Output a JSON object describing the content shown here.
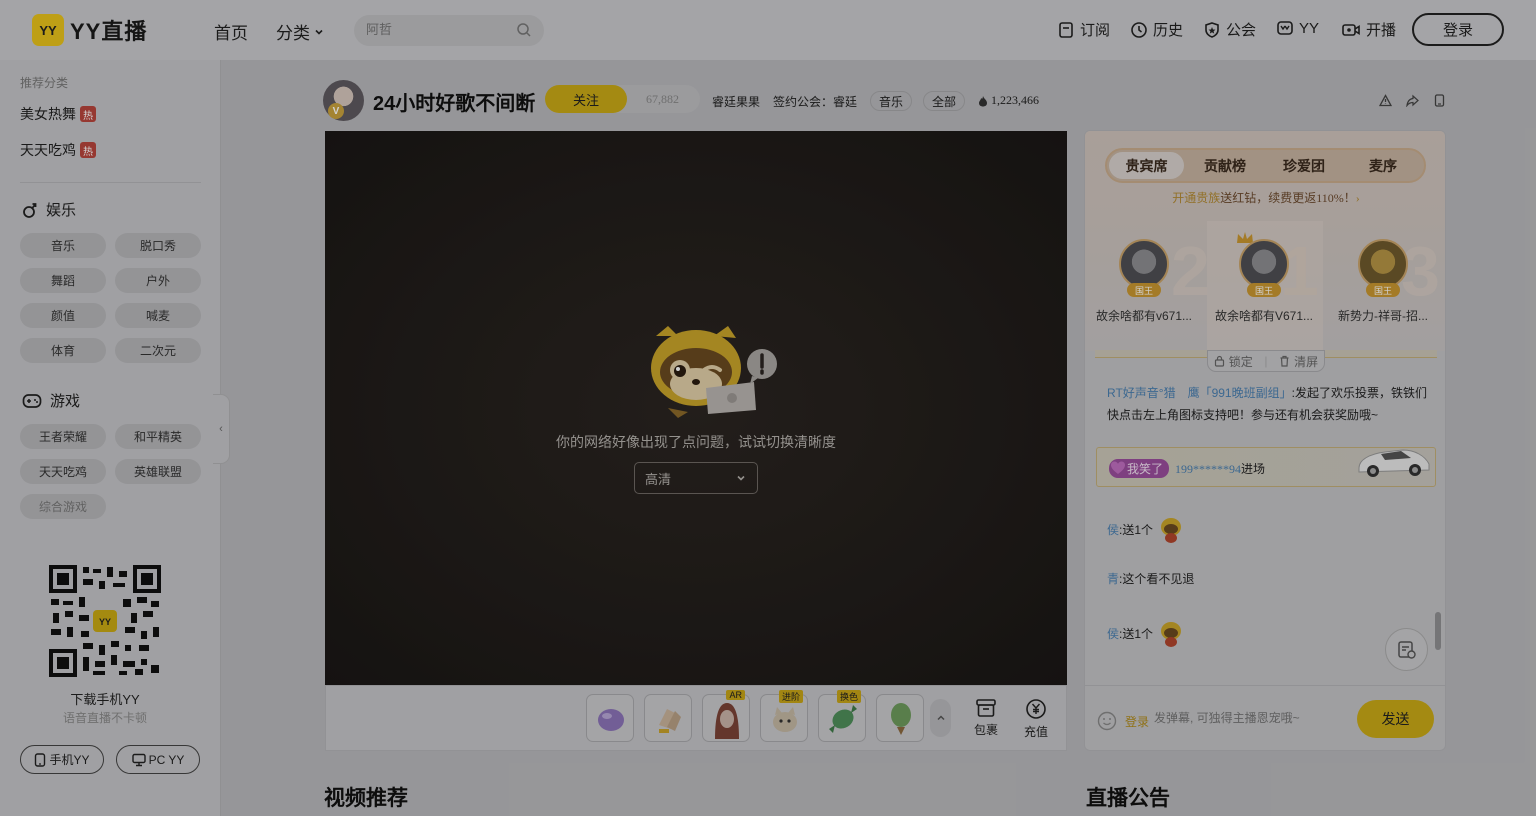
{
  "header": {
    "logo_mark": "YY",
    "logo_text": "YY直播",
    "nav": [
      "首页",
      "分类"
    ],
    "search_placeholder": "阿哲",
    "actions": [
      "订阅",
      "历史",
      "公会",
      "YY",
      "开播"
    ],
    "login": "登录"
  },
  "sidebar": {
    "caption": "推荐分类",
    "hot_items": [
      {
        "label": "美女热舞",
        "badge": "热"
      },
      {
        "label": "天天吃鸡",
        "badge": "热"
      }
    ],
    "entertainment": {
      "title": "娱乐",
      "chips": [
        "音乐",
        "脱口秀",
        "舞蹈",
        "户外",
        "颜值",
        "喊麦",
        "体育",
        "二次元"
      ]
    },
    "games": {
      "title": "游戏",
      "chips": [
        "王者荣耀",
        "和平精英",
        "天天吃鸡",
        "英雄联盟",
        "综合游戏"
      ]
    },
    "qr_caption": "下载手机YY",
    "qr_sub": "语音直播不卡顿",
    "downloads": [
      "手机YY",
      "PC YY"
    ]
  },
  "room": {
    "title": "24小时好歌不间断",
    "follow": "关注",
    "followers": "67,882",
    "anchor": "睿廷果果",
    "guild": "签约公会：睿廷",
    "tags": [
      "音乐",
      "全部"
    ],
    "heat": "1,223,466"
  },
  "player": {
    "error": "你的网络好像出现了点问题，试试切换清晰度",
    "quality": "高清",
    "gift_tags": {
      "g3": "AR",
      "g4": "进阶",
      "g5": "换色"
    },
    "tools": [
      "包裹",
      "充值"
    ]
  },
  "panel": {
    "tabs": [
      "贵宾席",
      "贡献榜",
      "珍爱团",
      "麦序"
    ],
    "noble_pre": "开通贵族",
    "noble_post": "送红钻，续费更返110%！",
    "vips": [
      {
        "rank": "2",
        "badge": "国王",
        "name": "故余啥都有v671..."
      },
      {
        "rank": "1",
        "badge": "国王",
        "name": "故余啥都有V671..."
      },
      {
        "rank": "3",
        "badge": "国王",
        "name": "新势力-祥哥-招..."
      }
    ],
    "lock": "锁定",
    "clear": "清屏",
    "chat": [
      {
        "user": "RT好声音°猎　鹰「991晚班副组」",
        "text": ":发起了欢乐投票，铁铁们快点击左上角图标支持吧！参与还有机会获奖励哦~"
      },
      {
        "user": "侯",
        "text": ":送1个"
      },
      {
        "user": "青",
        "text": ":这个看不见退"
      },
      {
        "user": "侯",
        "text": ":送1个"
      }
    ],
    "entry_label": "我笑了",
    "entry_user": "199******94",
    "entry_text": "进场",
    "input_login": "登录",
    "input_placeholder": "发弹幕, 可独得主播恩宠哦~",
    "send": "发送"
  },
  "sections": [
    "视频推荐",
    "直播公告"
  ]
}
